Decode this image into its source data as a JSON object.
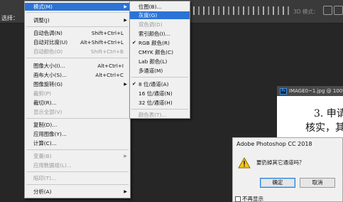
{
  "topbar": {
    "left_label": "选择：",
    "mode_3d": "3D 模式："
  },
  "image_menu": {
    "items": [
      {
        "label": "模式(M)",
        "has_arrow": true,
        "highlighted": true
      },
      {
        "label": "调整(J)",
        "has_arrow": true
      },
      {
        "label": "自动色调(N)",
        "shortcut": "Shift+Ctrl+L"
      },
      {
        "label": "自动对比度(U)",
        "shortcut": "Alt+Shift+Ctrl+L"
      },
      {
        "label": "自动颜色(O)",
        "shortcut": "Shift+Ctrl+B",
        "disabled": true
      },
      {
        "label": "图像大小(I)...",
        "shortcut": "Alt+Ctrl+I"
      },
      {
        "label": "画布大小(S)...",
        "shortcut": "Alt+Ctrl+C"
      },
      {
        "label": "图像旋转(G)",
        "has_arrow": true
      },
      {
        "label": "裁剪(P)",
        "disabled": true
      },
      {
        "label": "裁切(R)..."
      },
      {
        "label": "显示全部(V)",
        "disabled": true
      },
      {
        "label": "复制(D)..."
      },
      {
        "label": "应用图像(Y)..."
      },
      {
        "label": "计算(C)..."
      },
      {
        "label": "变量(B)",
        "has_arrow": true,
        "disabled": true
      },
      {
        "label": "应用数据组(L)...",
        "disabled": true
      },
      {
        "label": "陷印(T)...",
        "disabled": true
      },
      {
        "label": "分析(A)",
        "has_arrow": true
      }
    ]
  },
  "mode_submenu": {
    "items": [
      {
        "label": "位图(B)..."
      },
      {
        "label": "灰度(G)",
        "highlighted": true
      },
      {
        "label": "双色调(D)",
        "disabled": true
      },
      {
        "label": "索引颜色(I)..."
      },
      {
        "label": "RGB 颜色(R)",
        "checked": true
      },
      {
        "label": "CMYK 颜色(C)"
      },
      {
        "label": "Lab 颜色(L)"
      },
      {
        "label": "多通道(M)"
      },
      {
        "label": "8 位/通道(A)",
        "checked": true
      },
      {
        "label": "16 位/通道(N)"
      },
      {
        "label": "32 位/通道(H)"
      },
      {
        "label": "颜色表(T)...",
        "disabled": true
      }
    ]
  },
  "document": {
    "tab_icon": "Ps",
    "tab_title": "IMAGE0~1.jpg @ 100%",
    "lines": [
      "3. 申请",
      "核实，其"
    ]
  },
  "dialog": {
    "title": "Adobe Photoshop CC 2018",
    "message": "要扔掉其它通道吗？",
    "ok": "确定",
    "cancel": "取消",
    "checkbox": "不再显示"
  },
  "colors": {
    "menu_bg": "#f0f0f0",
    "highlight": "#2b73d6",
    "workspace": "#262626",
    "toolbar": "#3a3a3a"
  }
}
